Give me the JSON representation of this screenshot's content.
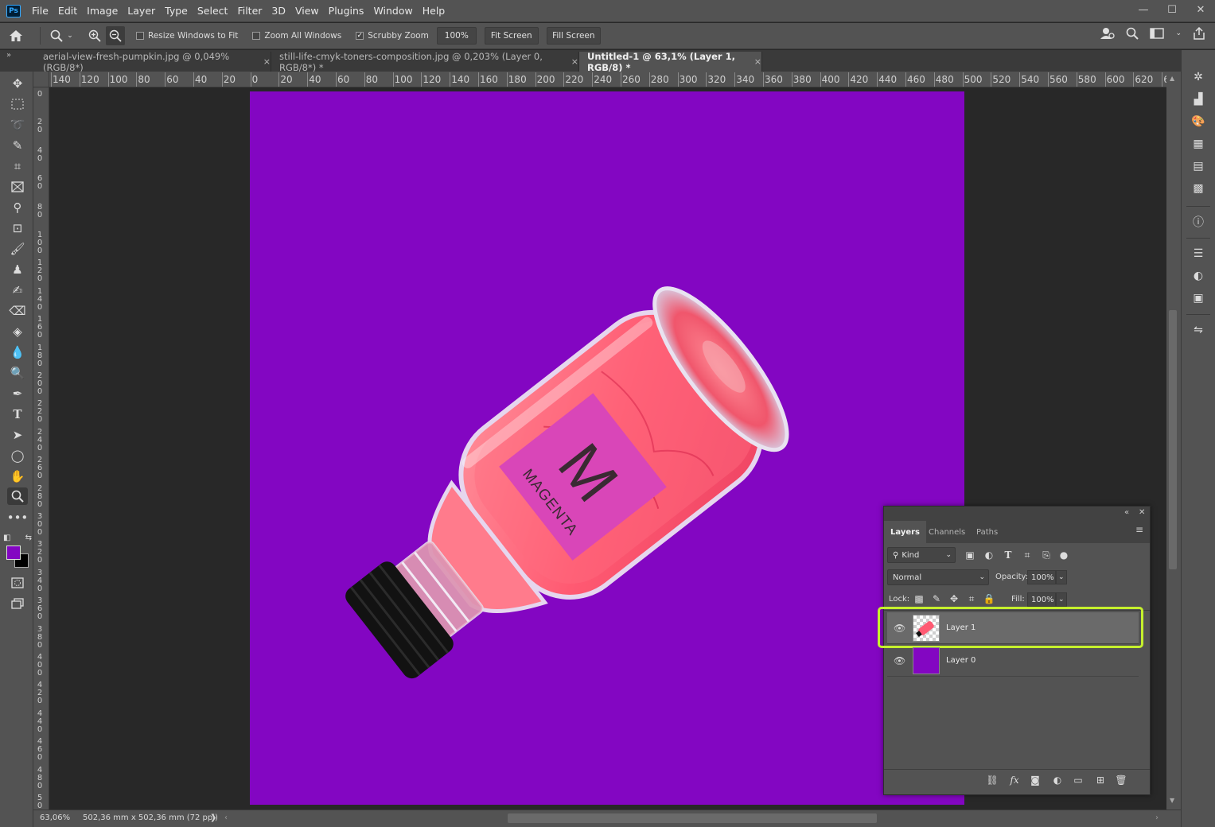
{
  "app": {
    "logo_text": "Ps",
    "menu": [
      "File",
      "Edit",
      "Image",
      "Layer",
      "Type",
      "Select",
      "Filter",
      "3D",
      "View",
      "Plugins",
      "Window",
      "Help"
    ],
    "window_controls": {
      "minimize": "—",
      "maximize": "☐",
      "close": "✕"
    }
  },
  "options_bar": {
    "resize_windows_label": "Resize Windows to Fit",
    "resize_windows_checked": false,
    "zoom_all_label": "Zoom All Windows",
    "zoom_all_checked": false,
    "scrubby_zoom_label": "Scrubby Zoom",
    "scrubby_zoom_checked": true,
    "zoom_value": "100%",
    "fit_screen_label": "Fit Screen",
    "fill_screen_label": "Fill Screen"
  },
  "tabs": [
    {
      "label": "aerial-view-fresh-pumpkin.jpg @ 0,049% (RGB/8*)",
      "close": "×",
      "active": false
    },
    {
      "label": "still-life-cmyk-toners-composition.jpg @ 0,203% (Layer 0, RGB/8*) *",
      "close": "×",
      "active": false
    },
    {
      "label": "Untitled-1 @ 63,1% (Layer 1, RGB/8) *",
      "close": "×",
      "active": true
    }
  ],
  "rulers": {
    "horizontal": [
      "140",
      "120",
      "100",
      "80",
      "60",
      "40",
      "20",
      "0",
      "20",
      "40",
      "60",
      "80",
      "100",
      "120",
      "140",
      "160",
      "180",
      "200",
      "220",
      "240",
      "260",
      "280",
      "300",
      "320",
      "340",
      "360",
      "380",
      "400",
      "420",
      "440",
      "460",
      "480",
      "500",
      "520",
      "540",
      "560",
      "580",
      "600",
      "620",
      "6"
    ],
    "vertical": [
      "0",
      "20",
      "40",
      "60",
      "80",
      "100",
      "120",
      "140",
      "160",
      "180",
      "200",
      "220",
      "240",
      "260",
      "280",
      "300",
      "320",
      "340",
      "360",
      "380",
      "400",
      "420",
      "440",
      "460",
      "480",
      "500"
    ]
  },
  "canvas": {
    "background_color": "#8306c2",
    "label_letter": "M",
    "label_text": "MAGENTA"
  },
  "layers_panel": {
    "collapse_icon": "«",
    "close_icon": "✕",
    "tabs": [
      "Layers",
      "Channels",
      "Paths"
    ],
    "kind_label": "Kind",
    "blend_mode": "Normal",
    "opacity_label": "Opacity:",
    "opacity_value": "100%",
    "lock_label": "Lock:",
    "fill_label": "Fill:",
    "fill_value": "100%",
    "layers": [
      {
        "name": "Layer 1",
        "selected": true
      },
      {
        "name": "Layer 0",
        "selected": false
      }
    ],
    "highlight_color": "#c5f02d"
  },
  "status": {
    "zoom": "63,06%",
    "doc_info": "502,36 mm x 502,36 mm (72 ppi)",
    "arrow": "❯"
  },
  "colors": {
    "foreground": "#8306c2",
    "background": "#000000"
  }
}
